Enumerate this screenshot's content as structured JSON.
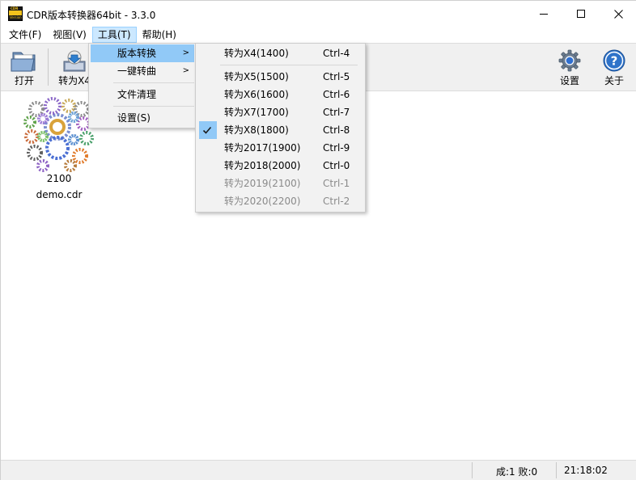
{
  "window": {
    "title": "CDR版本转换器64bit - 3.3.0",
    "icon_text_top": "CDR",
    "icon_text_bottom": "Version"
  },
  "menubar": {
    "items": [
      {
        "label": "文件(F)"
      },
      {
        "label": "视图(V)"
      },
      {
        "label": "工具(T)",
        "active": true
      },
      {
        "label": "帮助(H)"
      }
    ]
  },
  "toolbar": {
    "open_label": "打开",
    "convert_label": "转为X4",
    "settings_label": "设置",
    "about_label": "关于"
  },
  "files": [
    {
      "version": "2100",
      "name": "demo.cdr"
    }
  ],
  "tools_menu": {
    "items": [
      {
        "label": "版本转换",
        "submenu": true,
        "highlighted": true
      },
      {
        "label": "一键转曲",
        "submenu": true
      },
      {
        "label": "文件清理"
      },
      {
        "label": "设置(S)"
      }
    ]
  },
  "version_menu": {
    "items": [
      {
        "label": "转为X4(1400)",
        "shortcut": "Ctrl-4",
        "enabled": true,
        "checked": false
      },
      {
        "label": "转为X5(1500)",
        "shortcut": "Ctrl-5",
        "enabled": true,
        "checked": false
      },
      {
        "label": "转为X6(1600)",
        "shortcut": "Ctrl-6",
        "enabled": true,
        "checked": false
      },
      {
        "label": "转为X7(1700)",
        "shortcut": "Ctrl-7",
        "enabled": true,
        "checked": false
      },
      {
        "label": "转为X8(1800)",
        "shortcut": "Ctrl-8",
        "enabled": true,
        "checked": true
      },
      {
        "label": "转为2017(1900)",
        "shortcut": "Ctrl-9",
        "enabled": true,
        "checked": false
      },
      {
        "label": "转为2018(2000)",
        "shortcut": "Ctrl-0",
        "enabled": true,
        "checked": false
      },
      {
        "label": "转为2019(2100)",
        "shortcut": "Ctrl-1",
        "enabled": false,
        "checked": false
      },
      {
        "label": "转为2020(2200)",
        "shortcut": "Ctrl-2",
        "enabled": false,
        "checked": false
      }
    ]
  },
  "statusbar": {
    "count": "成:1 败:0",
    "time": "21:18:02"
  },
  "colors": {
    "highlight": "#91c9f7",
    "menu_active_bg": "#cce8ff",
    "toolbar_bg": "#f0f0f0",
    "disabled_text": "#8a8a8a"
  }
}
